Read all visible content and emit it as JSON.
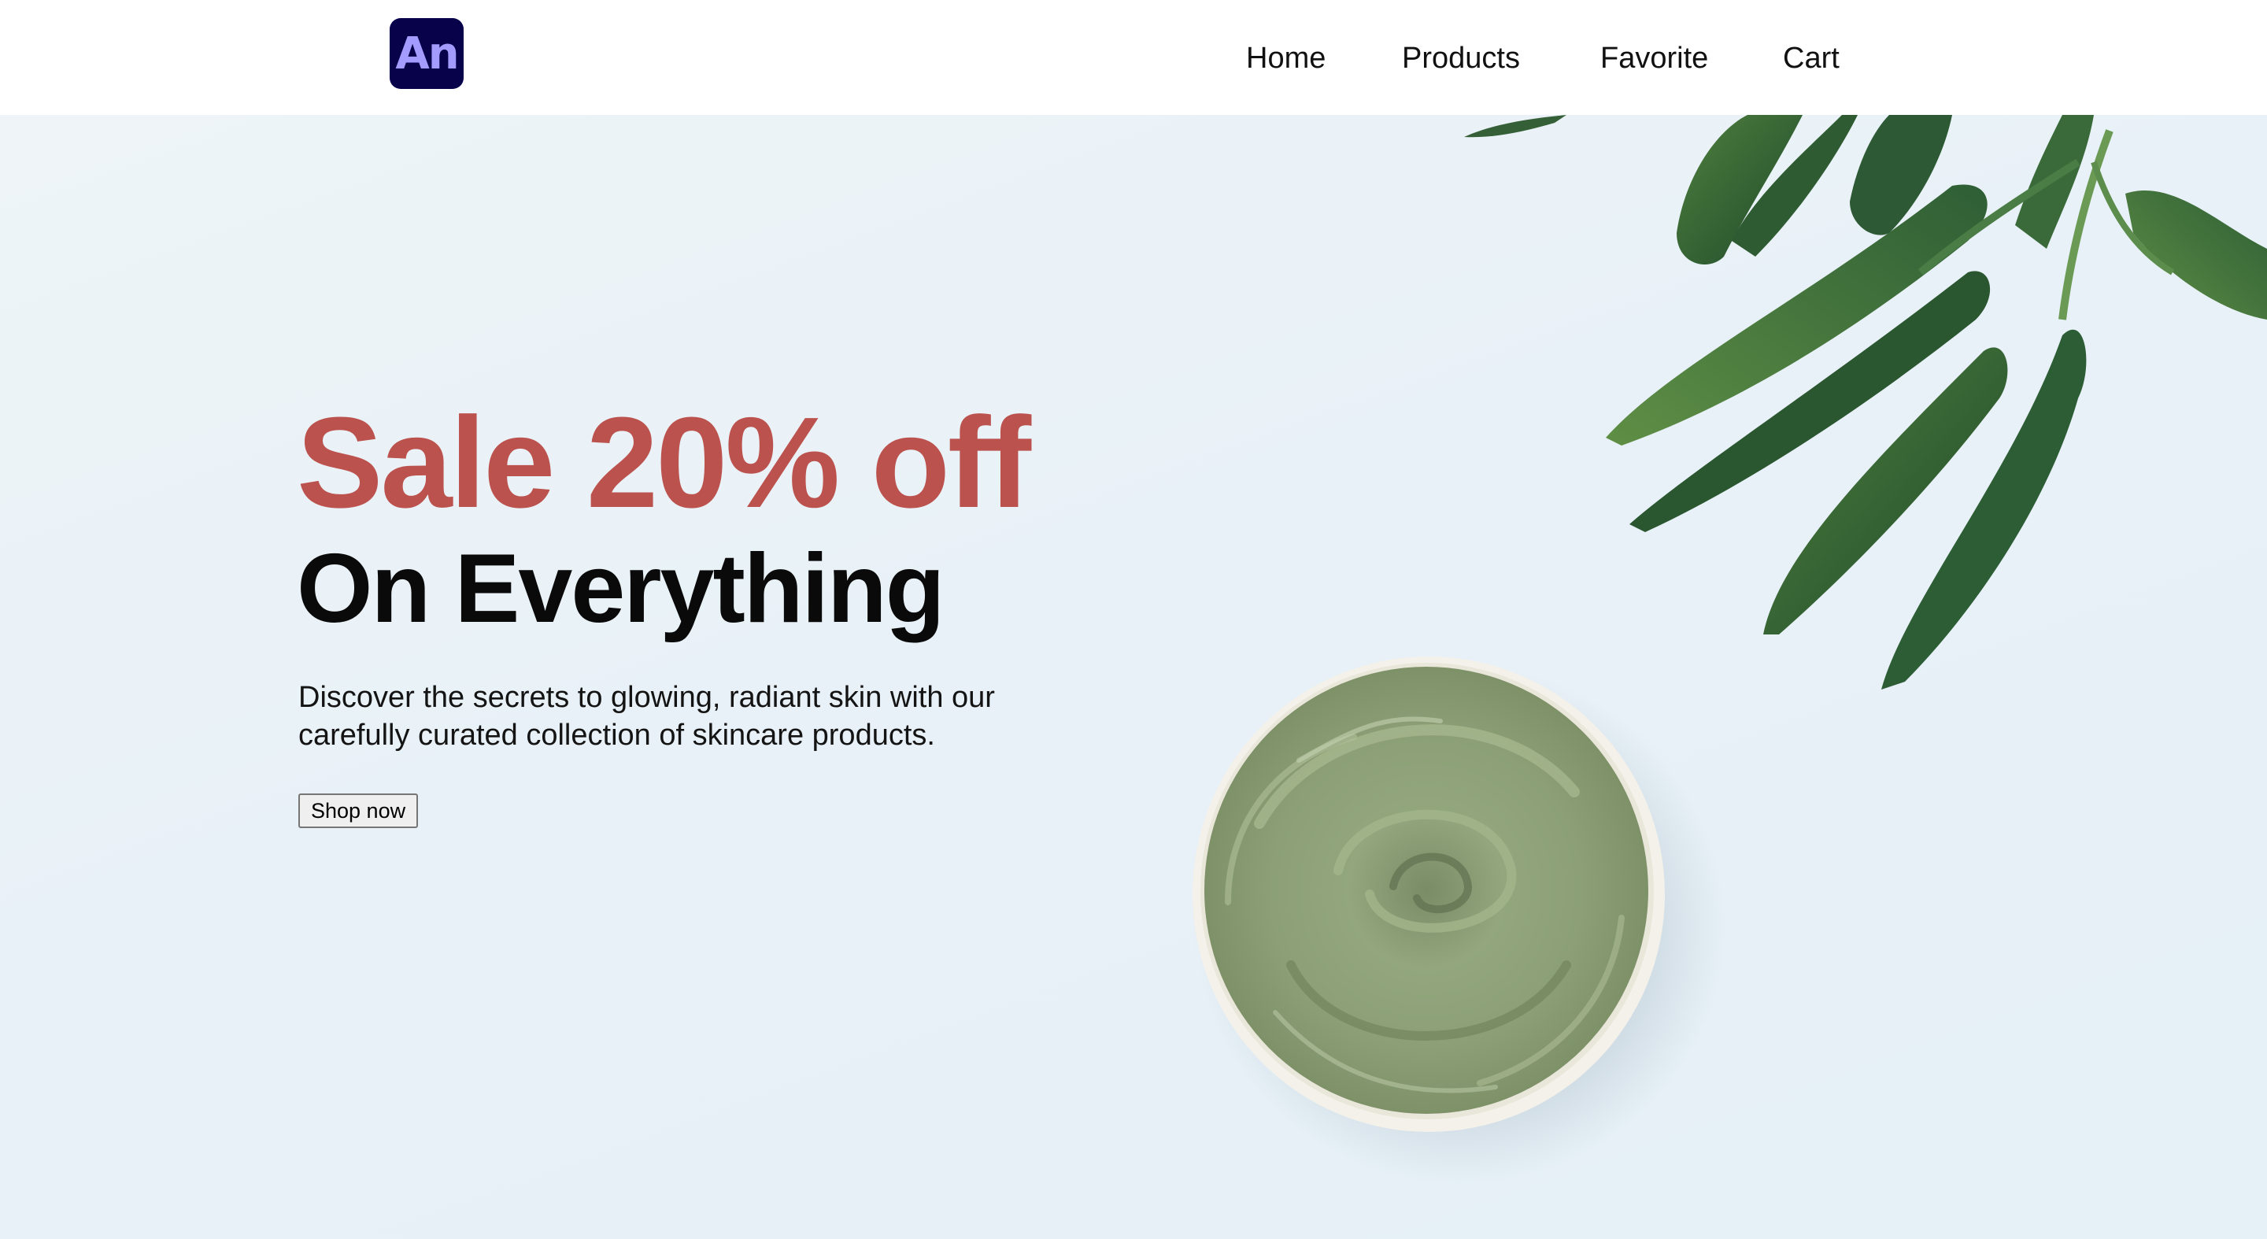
{
  "brand": {
    "logo_text": "An",
    "logo_bg": "#07024a",
    "logo_fg": "#a49bff"
  },
  "nav": {
    "items": [
      {
        "label": "Home"
      },
      {
        "label": "Products"
      },
      {
        "label": "Favorite"
      },
      {
        "label": "Cart"
      }
    ]
  },
  "hero": {
    "headline": "Sale 20% off",
    "subheadline": "On Everything",
    "description": "Discover the secrets to glowing, radiant skin with our carefully curated collection of skincare products.",
    "cta_label": "Shop now",
    "accent_color": "#bc524d",
    "image_subject": "green clay mask bowl with leaves"
  }
}
